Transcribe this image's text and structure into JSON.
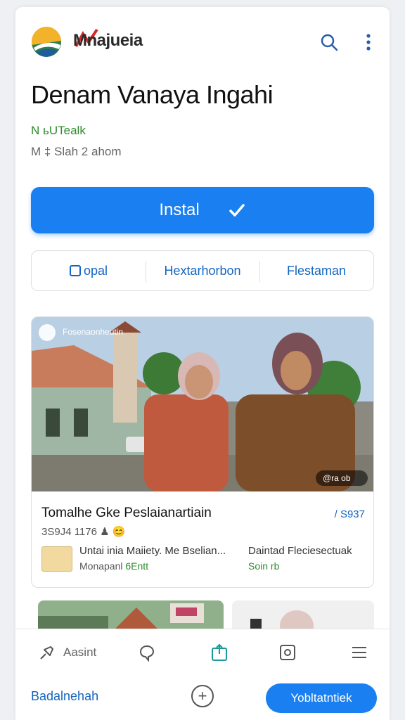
{
  "header": {
    "brand": "Mnajueia",
    "icons": [
      "search-icon",
      "more-vert-icon"
    ]
  },
  "app": {
    "title": "Denam Vanaya Ingahi",
    "developer": "N ьUTealk",
    "meta": "M ‡ Slah 2 ahom"
  },
  "install": {
    "label": "Instal",
    "icon": "check-pen-icon"
  },
  "tabs": [
    {
      "label": "opal",
      "icon": "square-icon"
    },
    {
      "label": "Hextarhorbon"
    },
    {
      "label": "Flestaman"
    }
  ],
  "card": {
    "photo_caption": "Fosenaonheutin",
    "photo_badge": "@ra ob",
    "title": "Tomalhe Gke Peslaianartiain",
    "meta": "3S9J4 1176 ♟ 😊",
    "badge": "/ S937",
    "row_a": "Untai inia Maiiety. Me Bselian...",
    "row_b_prefix": "Monapanl",
    "row_b_accent": "6Entt",
    "row_c": "Daintad Fleciesectuak",
    "row_d": "Soin rb"
  },
  "bottom_nav": [
    {
      "label": "Aasint",
      "icon": "pin-icon"
    },
    {
      "label": "",
      "icon": "chat-icon"
    },
    {
      "label": "",
      "icon": "share-icon"
    },
    {
      "label": "",
      "icon": "document-icon"
    },
    {
      "label": "",
      "icon": "menu-icon"
    }
  ],
  "footer": {
    "left": "Badalnehah",
    "add": "+",
    "button": "Yobltatntiek"
  },
  "colors": {
    "accent": "#1a7ff0",
    "link": "#1565c0",
    "green": "#2e8b2e"
  }
}
